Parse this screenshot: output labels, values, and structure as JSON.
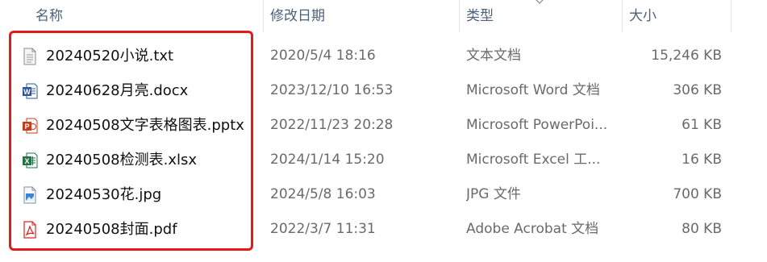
{
  "columns": {
    "name": "名称",
    "date": "修改日期",
    "type": "类型",
    "size": "大小"
  },
  "files": [
    {
      "name": "20240520小说.txt",
      "date": "2020/5/4 18:16",
      "type": "文本文档",
      "size": "15,246 KB",
      "icon": "text-file-icon"
    },
    {
      "name": "20240628月亮.docx",
      "date": "2023/12/10 16:53",
      "type": "Microsoft Word 文档",
      "size": "306 KB",
      "icon": "word-file-icon"
    },
    {
      "name": "20240508文字表格图表.pptx",
      "date": "2022/11/23 20:28",
      "type": "Microsoft PowerPoi...",
      "size": "61 KB",
      "icon": "powerpoint-file-icon"
    },
    {
      "name": "20240508检测表.xlsx",
      "date": "2024/1/14 15:20",
      "type": "Microsoft Excel 工...",
      "size": "16 KB",
      "icon": "excel-file-icon"
    },
    {
      "name": "20240530花.jpg",
      "date": "2024/5/8 16:03",
      "type": "JPG 文件",
      "size": "700 KB",
      "icon": "image-file-icon"
    },
    {
      "name": "20240508封面.pdf",
      "date": "2022/3/7 11:31",
      "type": "Adobe Acrobat 文档",
      "size": "80 KB",
      "icon": "pdf-file-icon"
    }
  ],
  "colors": {
    "highlight_border": "#e51919",
    "header_text": "#4c607a"
  }
}
